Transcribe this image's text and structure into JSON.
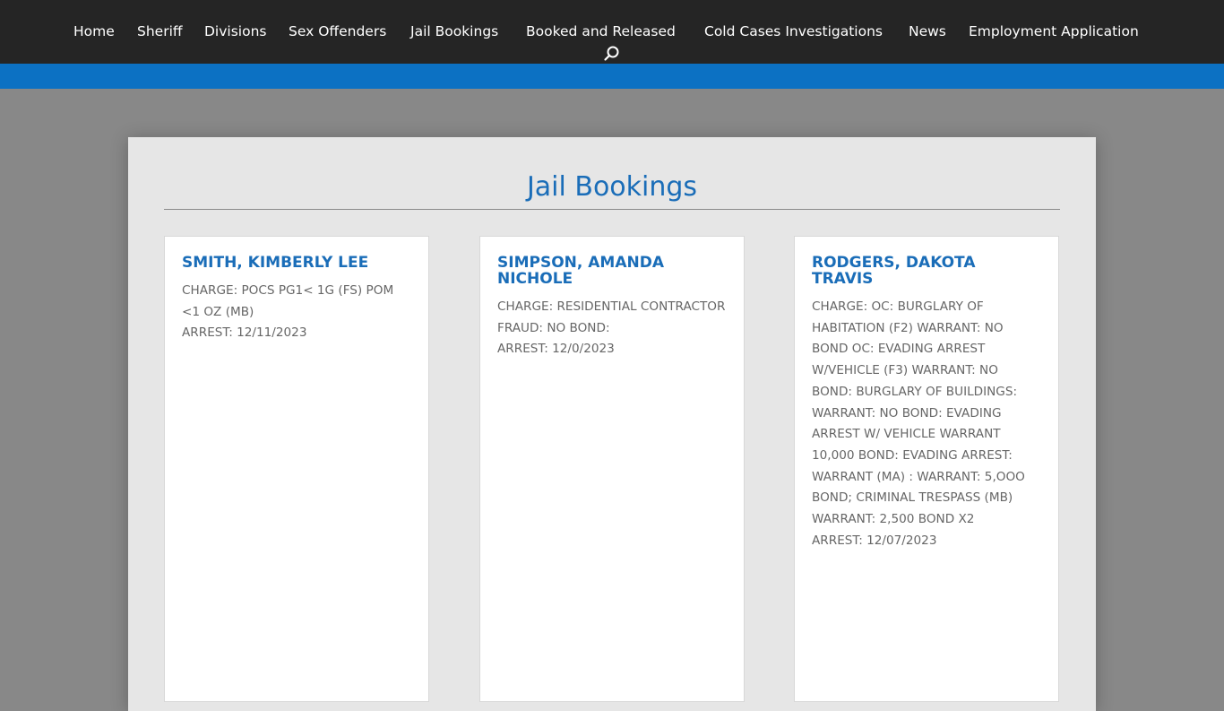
{
  "nav": {
    "items": [
      "Home",
      "Sheriff",
      "Divisions",
      "Sex Offenders",
      "Jail Bookings",
      "Booked and Released",
      "Cold Cases Investigations",
      "News",
      "Employment Application"
    ],
    "search_icon": "search-icon"
  },
  "colors": {
    "nav_bg": "#252525",
    "accent_bar": "#0c71c3",
    "title": "#1a6db8",
    "page_bg": "#888888",
    "panel_bg": "#e6e6e6"
  },
  "page": {
    "title": "Jail Bookings"
  },
  "bookings": [
    {
      "name": "SMITH, KIMBERLY LEE",
      "charge": "CHARGE: POCS PG1< 1G (FS) POM <1 OZ (MB)",
      "arrest": "ARREST: 12/11/2023"
    },
    {
      "name": "SIMPSON, AMANDA NICHOLE",
      "charge": "CHARGE: RESIDENTIAL CONTRACTOR FRAUD: NO BOND:",
      "arrest": "ARREST: 12/0/2023"
    },
    {
      "name": "RODGERS, DAKOTA TRAVIS",
      "charge": "CHARGE: OC: BURGLARY OF HABITATION (F2) WARRANT: NO BOND OC: EVADING ARREST W/VEHICLE (F3) WARRANT: NO BOND: BURGLARY OF BUILDINGS: WARRANT: NO BOND: EVADING ARREST W/ VEHICLE WARRANT 10,000 BOND: EVADING ARREST: WARRANT (MA) : WARRANT: 5,OOO BOND; CRIMINAL TRESPASS (MB) WARRANT: 2,500 BOND X2",
      "arrest": "ARREST: 12/07/2023"
    }
  ]
}
